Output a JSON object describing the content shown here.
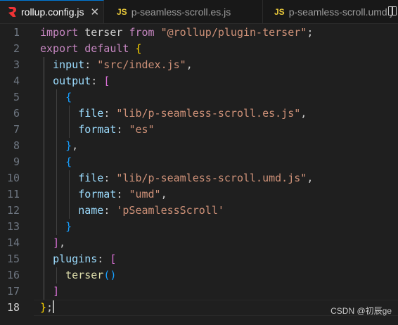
{
  "tabs": [
    {
      "label": "rollup.config.js",
      "icon": "rollup-icon",
      "active": true,
      "close": "✕"
    },
    {
      "label": "p-seamless-scroll.es.js",
      "icon": "js-icon",
      "icon_text": "JS",
      "active": false
    },
    {
      "label": "p-seamless-scroll.umd.js",
      "icon": "js-icon",
      "icon_text": "JS",
      "active": false
    }
  ],
  "colors": {
    "keyword": "#569cd6",
    "control_keyword": "#c586c0",
    "string": "#ce9178",
    "property": "#9cdcfe",
    "function": "#dcdcaa",
    "bracket_1": "#ffd700",
    "bracket_2": "#da70d6",
    "bracket_3": "#179fff",
    "rollup": "#ef3335",
    "js": "#e8c83a"
  },
  "editor": {
    "current_line": 18,
    "lines": [
      {
        "n": "1",
        "tokens": [
          [
            "kw2",
            "import"
          ],
          [
            "plain",
            " "
          ],
          [
            "plain",
            "terser"
          ],
          [
            "plain",
            " "
          ],
          [
            "kw2",
            "from"
          ],
          [
            "plain",
            " "
          ],
          [
            "str",
            "\"@rollup/plugin-terser\""
          ],
          [
            "plain",
            ";"
          ]
        ]
      },
      {
        "n": "2",
        "tokens": [
          [
            "kw2",
            "export"
          ],
          [
            "plain",
            " "
          ],
          [
            "kw2",
            "default"
          ],
          [
            "plain",
            " "
          ],
          [
            "b1",
            "{"
          ]
        ]
      },
      {
        "n": "3",
        "tokens": [
          [
            "plain",
            "  "
          ],
          [
            "prop",
            "input"
          ],
          [
            "plain",
            ": "
          ],
          [
            "str",
            "\"src/index.js\""
          ],
          [
            "plain",
            ","
          ]
        ]
      },
      {
        "n": "4",
        "tokens": [
          [
            "plain",
            "  "
          ],
          [
            "prop",
            "output"
          ],
          [
            "plain",
            ": "
          ],
          [
            "b2",
            "["
          ]
        ]
      },
      {
        "n": "5",
        "tokens": [
          [
            "plain",
            "    "
          ],
          [
            "b3",
            "{"
          ]
        ]
      },
      {
        "n": "6",
        "tokens": [
          [
            "plain",
            "      "
          ],
          [
            "prop",
            "file"
          ],
          [
            "plain",
            ": "
          ],
          [
            "str",
            "\"lib/p-seamless-scroll.es.js\""
          ],
          [
            "plain",
            ","
          ]
        ]
      },
      {
        "n": "7",
        "tokens": [
          [
            "plain",
            "      "
          ],
          [
            "prop",
            "format"
          ],
          [
            "plain",
            ": "
          ],
          [
            "str",
            "\"es\""
          ]
        ]
      },
      {
        "n": "8",
        "tokens": [
          [
            "plain",
            "    "
          ],
          [
            "b3",
            "}"
          ],
          [
            "plain",
            ","
          ]
        ]
      },
      {
        "n": "9",
        "tokens": [
          [
            "plain",
            "    "
          ],
          [
            "b3",
            "{"
          ]
        ]
      },
      {
        "n": "10",
        "tokens": [
          [
            "plain",
            "      "
          ],
          [
            "prop",
            "file"
          ],
          [
            "plain",
            ": "
          ],
          [
            "str",
            "\"lib/p-seamless-scroll.umd.js\""
          ],
          [
            "plain",
            ","
          ]
        ]
      },
      {
        "n": "11",
        "tokens": [
          [
            "plain",
            "      "
          ],
          [
            "prop",
            "format"
          ],
          [
            "plain",
            ": "
          ],
          [
            "str",
            "\"umd\""
          ],
          [
            "plain",
            ","
          ]
        ]
      },
      {
        "n": "12",
        "tokens": [
          [
            "plain",
            "      "
          ],
          [
            "prop",
            "name"
          ],
          [
            "plain",
            ": "
          ],
          [
            "str",
            "'pSeamlessScroll'"
          ]
        ]
      },
      {
        "n": "13",
        "tokens": [
          [
            "plain",
            "    "
          ],
          [
            "b3",
            "}"
          ]
        ]
      },
      {
        "n": "14",
        "tokens": [
          [
            "plain",
            "  "
          ],
          [
            "b2",
            "]"
          ],
          [
            "plain",
            ","
          ]
        ]
      },
      {
        "n": "15",
        "tokens": [
          [
            "plain",
            "  "
          ],
          [
            "prop",
            "plugins"
          ],
          [
            "plain",
            ": "
          ],
          [
            "b2",
            "["
          ]
        ]
      },
      {
        "n": "16",
        "tokens": [
          [
            "plain",
            "    "
          ],
          [
            "fn",
            "terser"
          ],
          [
            "b3",
            "()"
          ]
        ]
      },
      {
        "n": "17",
        "tokens": [
          [
            "plain",
            "  "
          ],
          [
            "b2",
            "]"
          ]
        ]
      },
      {
        "n": "18",
        "tokens": [
          [
            "b1",
            "}"
          ],
          [
            "plain",
            ";"
          ]
        ]
      }
    ]
  },
  "watermark": "CSDN @初辰ge"
}
